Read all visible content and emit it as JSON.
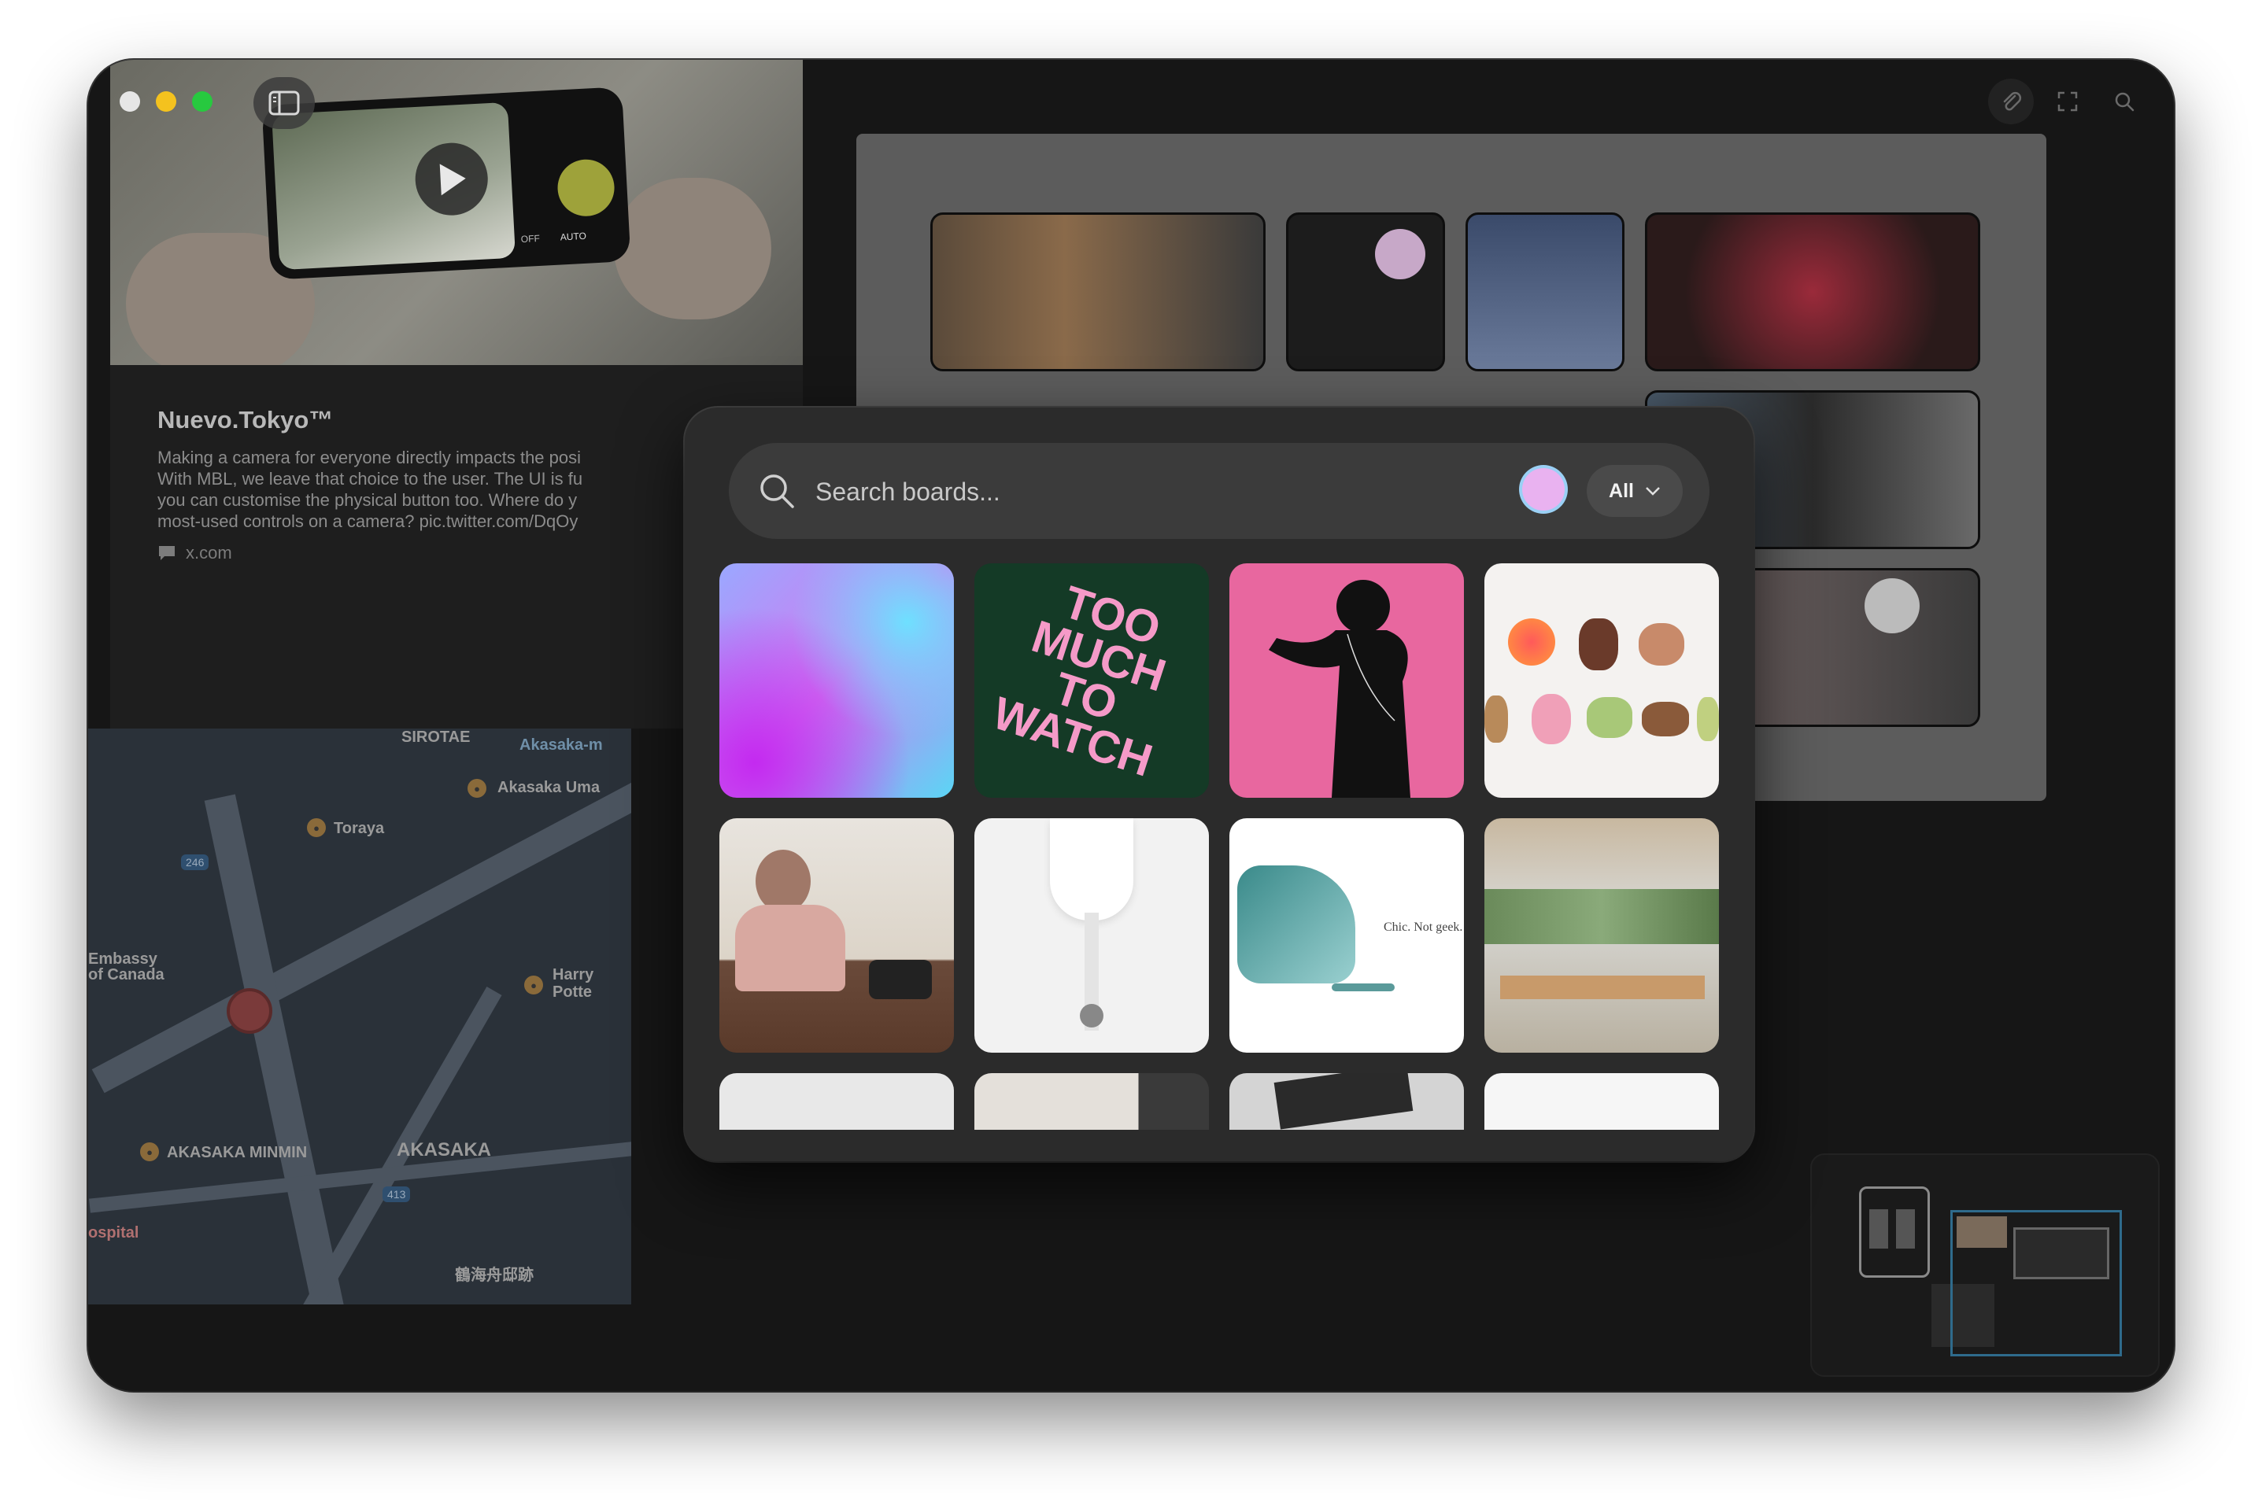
{
  "window": {
    "traffic_lights": {
      "close": "#e6e6e6",
      "minimize": "#f4c21e",
      "maximize": "#27c93f"
    },
    "sidebar_toggle_icon": "sidebar-icon",
    "toolbar_icons": [
      "paperclip-icon",
      "fullscreen-icon",
      "search-icon"
    ]
  },
  "tweet_card": {
    "title": "Nuevo.Tokyo™",
    "body_lines": [
      "Making a camera for everyone directly impacts the posi",
      "With MBL, we leave that choice to the user. The UI is fu",
      "you can customise the physical button too. Where do y",
      "most-used controls on a camera? pic.twitter.com/DqOy"
    ],
    "source": "x.com",
    "phone_labels": {
      "auto": "AUTO",
      "off": "OFF"
    }
  },
  "map_card": {
    "labels": [
      {
        "text": "SIROTAE",
        "tag": "sirotae"
      },
      {
        "text": "Akasaka-m",
        "tag": "akasaka-m"
      },
      {
        "text": "Akasaka Uma",
        "tag": "akasaka-uma"
      },
      {
        "text": "Toraya",
        "tag": "toraya"
      },
      {
        "text": "Embassy",
        "tag": "embassy"
      },
      {
        "text": "of Canada",
        "tag": "of-canada"
      },
      {
        "text": "Harry",
        "tag": "harry"
      },
      {
        "text": "Potte",
        "tag": "potte"
      },
      {
        "text": "AKASAKA MINMIN",
        "tag": "akasaka-minmin"
      },
      {
        "text": "AKASAKA",
        "tag": "akasaka"
      },
      {
        "text": "ospital",
        "tag": "hospital"
      },
      {
        "text": "鶴海舟邸跡",
        "tag": "landmark"
      }
    ],
    "route_badges": [
      "246",
      "413"
    ]
  },
  "search": {
    "placeholder": "Search boards...",
    "value": "",
    "color_filter": "#e9b2f0",
    "filter_label": "All"
  },
  "boards": [
    {
      "name": "gradient",
      "kind": "gradient"
    },
    {
      "name": "too-much-to-watch",
      "kind": "poster",
      "text": "TOO MUCH TO WATCH"
    },
    {
      "name": "ipod-silhouette",
      "kind": "silhouette"
    },
    {
      "name": "color-blobs",
      "kind": "blobs"
    },
    {
      "name": "man-with-binoculars",
      "kind": "photo"
    },
    {
      "name": "white-product",
      "kind": "product"
    },
    {
      "name": "imac-chic-not-geek",
      "kind": "ad",
      "text": "Chic. Not geek."
    },
    {
      "name": "apple-store-interior",
      "kind": "photo"
    },
    {
      "name": "keyboard-grid",
      "kind": "partial"
    },
    {
      "name": "room-partial",
      "kind": "partial"
    },
    {
      "name": "device-chart",
      "kind": "partial"
    },
    {
      "name": "white-partial",
      "kind": "partial"
    }
  ]
}
